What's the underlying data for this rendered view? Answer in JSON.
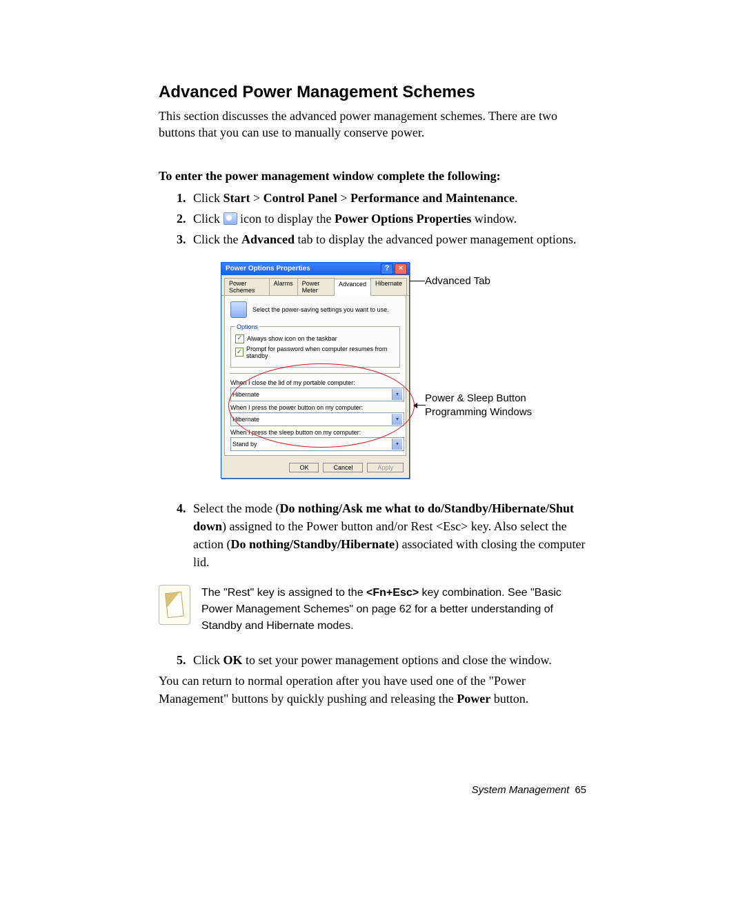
{
  "heading": "Advanced Power Management Schemes",
  "intro": "This section discusses the advanced power management schemes. There are two buttons that you can use to manually conserve power.",
  "subhead": "To enter the power management window complete the following:",
  "steps": {
    "s1_pre": "Click ",
    "s1_b1": "Start",
    "s1_sep1": " > ",
    "s1_b2": "Control Panel",
    "s1_sep2": " > ",
    "s1_b3": "Performance and Maintenance",
    "s1_post": ".",
    "s2_pre": "Click ",
    "s2_mid": " icon to display the ",
    "s2_b": "Power Options Properties",
    "s2_post": " window.",
    "s3_pre": "Click the ",
    "s3_b": "Advanced",
    "s3_post": " tab to display the advanced power management options.",
    "s4_pre": "Select the mode (",
    "s4_b1": "Do nothing/Ask me what to do/Standby/Hibernate/Shut down",
    "s4_mid": ") assigned to the Power button and/or Rest <Esc> key. Also select the action (",
    "s4_b2": "Do nothing/Standby/Hibernate",
    "s4_post": ") associated with closing the computer lid.",
    "s5_pre": "Click ",
    "s5_b": "OK",
    "s5_post": " to set your power management options and close the window."
  },
  "dialog": {
    "title": "Power Options Properties",
    "tabs": [
      "Power Schemes",
      "Alarms",
      "Power Meter",
      "Advanced",
      "Hibernate"
    ],
    "activeTab": 3,
    "hint": "Select the power-saving settings you want to use.",
    "optionsLegend": "Options",
    "chk1": "Always show icon on the taskbar",
    "chk2": "Prompt for password when computer resumes from standby",
    "lbl_lid": "When I close the lid of my portable computer:",
    "val_lid": "Hibernate",
    "lbl_power": "When I press the power button on my computer:",
    "val_power": "Hibernate",
    "lbl_sleep": "When I press the sleep button on my computer:",
    "val_sleep": "Stand by",
    "ok": "OK",
    "cancel": "Cancel",
    "apply": "Apply"
  },
  "callouts": {
    "top": "Advanced Tab",
    "mid": "Power  & Sleep Button Programming Windows"
  },
  "note": {
    "t1": "The \"Rest\" key is assigned to the ",
    "b1": "<Fn+Esc>",
    "t2": " key combination. See  \"Basic Power Management Schemes\" on page 62 for a better understanding of Standby and Hibernate modes."
  },
  "closing": {
    "t1": "You can return to normal operation after you have used one of the \"Power Management\" buttons by quickly pushing and releasing the ",
    "b1": "Power",
    "t2": " button."
  },
  "footer": {
    "section": "System Management",
    "page": "65"
  }
}
